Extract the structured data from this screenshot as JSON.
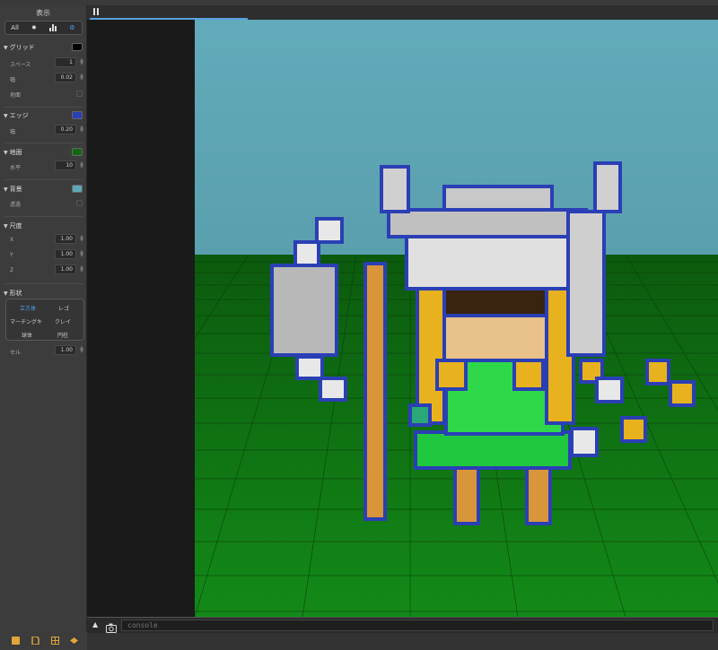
{
  "panel": {
    "title": "表示",
    "tabs": [
      {
        "label": "All",
        "icon": "all-text"
      },
      {
        "label": "",
        "icon": "sun-icon"
      },
      {
        "label": "",
        "icon": "bar-chart-icon"
      },
      {
        "label": "",
        "icon": "gear-icon"
      }
    ],
    "grid": {
      "title": "グリッド",
      "color": "#000000",
      "spacing_label": "スペース",
      "spacing_value": "1",
      "width_label": "幅",
      "width_value": "0.02",
      "ground_label": "地面"
    },
    "edge": {
      "title": "エッジ",
      "color": "#2b3fb5",
      "width_label": "幅",
      "width_value": "0.20"
    },
    "ground": {
      "title": "地面",
      "color": "#0f6a12",
      "level_label": "水平",
      "level_value": "10"
    },
    "background": {
      "title": "背景",
      "color": "#5fa8b8",
      "transparent_label": "透過"
    },
    "scale": {
      "title": "尺度",
      "x_label": "X",
      "x_value": "1.00",
      "y_label": "Y",
      "y_value": "1.00",
      "z_label": "Z",
      "z_value": "1.00"
    },
    "shape": {
      "title": "形状",
      "options": [
        "立方体",
        "レゴ",
        "マーチングキ",
        "クレイ",
        "球体",
        "円柱"
      ],
      "selected": "立方体",
      "cell_label": "セル",
      "cell_value": "1.00"
    }
  },
  "bottom_tools": [
    "cube-icon",
    "file-icon",
    "grid-icon",
    "layers-icon"
  ],
  "console": {
    "placeholder": "console"
  },
  "colors": {
    "sky": "#5fa8b8",
    "ground": "#0f6a12",
    "edge": "#2b3fb5",
    "accent": "#4aa3f0"
  }
}
